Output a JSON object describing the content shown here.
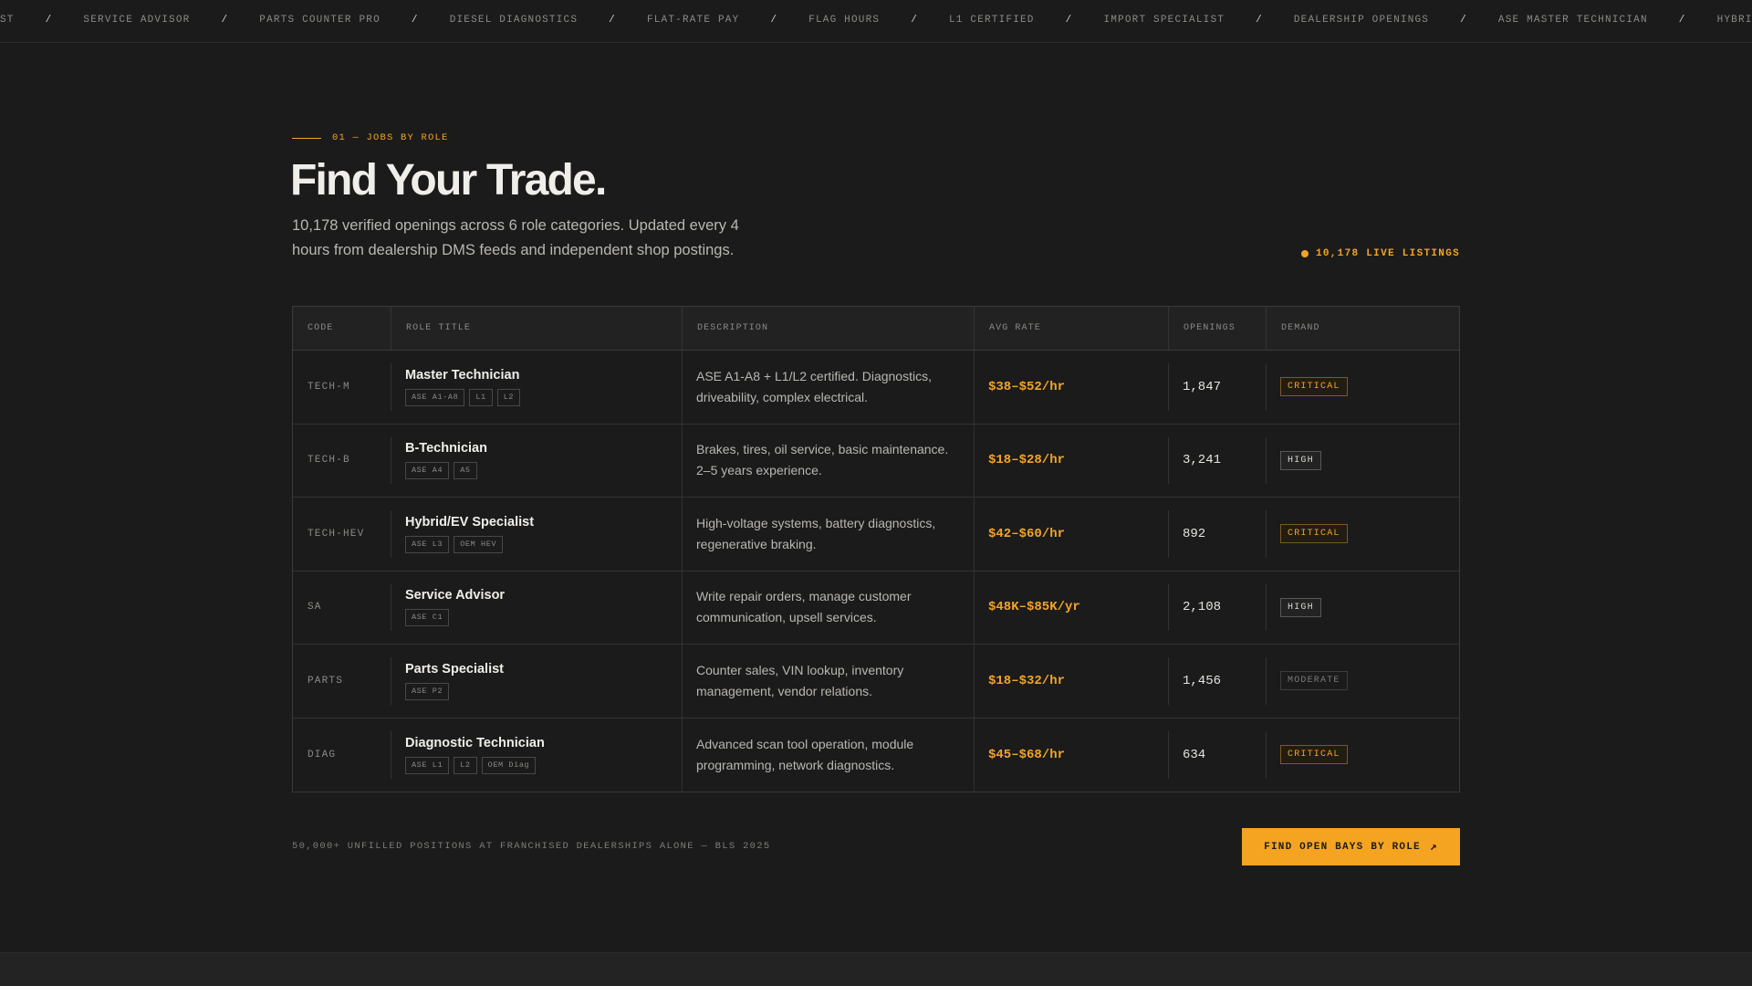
{
  "ticker": [
    "ST",
    "SERVICE ADVISOR",
    "PARTS COUNTER PRO",
    "DIESEL DIAGNOSTICS",
    "FLAT-RATE PAY",
    "FLAG HOURS",
    "L1 CERTIFIED",
    "IMPORT SPECIALIST",
    "DEALERSHIP OPENINGS",
    "ASE MASTER TECHNICIAN",
    "HYBRID / EV SPECIALIST"
  ],
  "ticker_separator": "/",
  "section": {
    "eyebrow": "01 — JOBS BY ROLE",
    "title": "Find Your Trade.",
    "subtitle": "10,178 verified openings across 6 role categories. Updated every 4 hours from dealership DMS feeds and independent shop postings.",
    "live_label": "10,178 LIVE LISTINGS"
  },
  "table": {
    "headers": {
      "code": "CODE",
      "role": "ROLE TITLE",
      "description": "DESCRIPTION",
      "rate": "AVG RATE",
      "openings": "OPENINGS",
      "demand": "DEMAND"
    },
    "rows": [
      {
        "code": "TECH-M",
        "title": "Master Technician",
        "tags": [
          "ASE A1-A8",
          "L1",
          "L2"
        ],
        "description": "ASE A1-A8 + L1/L2 certified. Diagnostics, driveability, complex electrical.",
        "rate": "$38–$52/hr",
        "openings": "1,847",
        "demand": "CRITICAL",
        "level": "critical"
      },
      {
        "code": "TECH-B",
        "title": "B-Technician",
        "tags": [
          "ASE A4",
          "A5"
        ],
        "description": "Brakes, tires, oil service, basic maintenance. 2–5 years experience.",
        "rate": "$18–$28/hr",
        "openings": "3,241",
        "demand": "HIGH",
        "level": "high"
      },
      {
        "code": "TECH-HEV",
        "title": "Hybrid/EV Specialist",
        "tags": [
          "ASE L3",
          "OEM HEV"
        ],
        "description": "High-voltage systems, battery diagnostics, regenerative braking.",
        "rate": "$42–$60/hr",
        "openings": "892",
        "demand": "CRITICAL",
        "level": "critical"
      },
      {
        "code": "SA",
        "title": "Service Advisor",
        "tags": [
          "ASE C1"
        ],
        "description": "Write repair orders, manage customer communication, upsell services.",
        "rate": "$48K–$85K/yr",
        "openings": "2,108",
        "demand": "HIGH",
        "level": "high"
      },
      {
        "code": "PARTS",
        "title": "Parts Specialist",
        "tags": [
          "ASE P2"
        ],
        "description": "Counter sales, VIN lookup, inventory management, vendor relations.",
        "rate": "$18–$32/hr",
        "openings": "1,456",
        "demand": "MODERATE",
        "level": "moderate"
      },
      {
        "code": "DIAG",
        "title": "Diagnostic Technician",
        "tags": [
          "ASE L1",
          "L2",
          "OEM Diag"
        ],
        "description": "Advanced scan tool operation, module programming, network diagnostics.",
        "rate": "$45–$68/hr",
        "openings": "634",
        "demand": "CRITICAL",
        "level": "critical"
      }
    ]
  },
  "footer": {
    "note": "50,000+ UNFILLED POSITIONS AT FRANCHISED DEALERSHIPS ALONE — BLS 2025",
    "cta_label": "FIND OPEN BAYS BY ROLE",
    "cta_icon": "arrow-up-right-icon"
  },
  "colors": {
    "background": "#1b1b1b",
    "accent": "#f2a428",
    "text": "#e6e4df",
    "muted": "#8a8a86"
  }
}
